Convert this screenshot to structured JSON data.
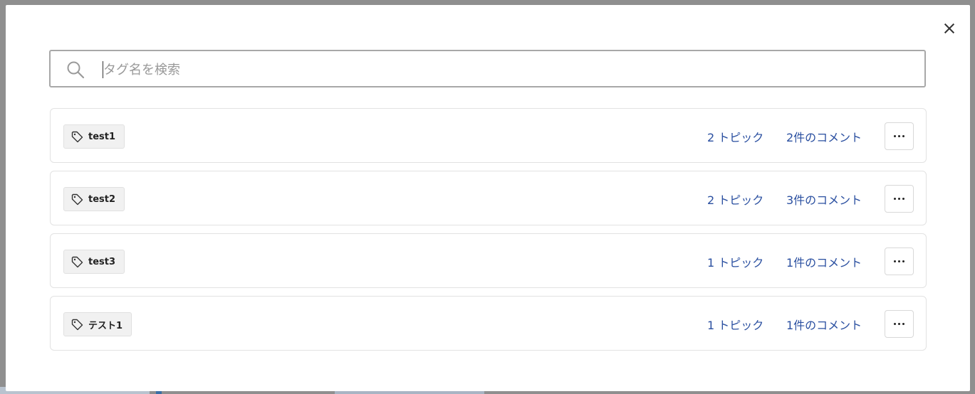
{
  "search": {
    "placeholder": "タグ名を検索",
    "value": ""
  },
  "tags": [
    {
      "name": "test1",
      "topics": "2 トピック",
      "comments": "2件のコメント"
    },
    {
      "name": "test2",
      "topics": "2 トピック",
      "comments": "3件のコメント"
    },
    {
      "name": "test3",
      "topics": "1 トピック",
      "comments": "1件のコメント"
    },
    {
      "name": "テスト1",
      "topics": "1 トピック",
      "comments": "1件のコメント"
    }
  ],
  "icons": {
    "close": "close-icon",
    "search": "search-icon",
    "tag": "tag-icon",
    "more": "more-horizontal-icon"
  },
  "colors": {
    "link": "#2a4fa0",
    "chip_bg": "#f1f1f1",
    "row_border": "#e2e2e2"
  }
}
